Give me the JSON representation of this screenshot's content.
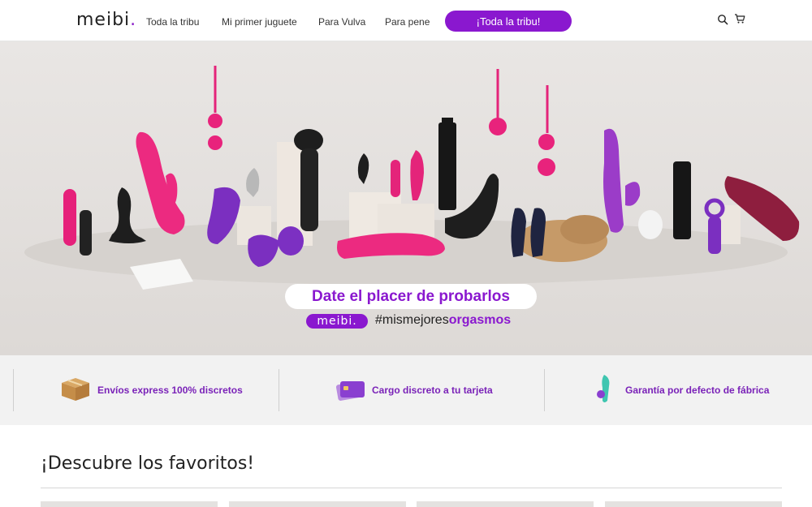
{
  "header": {
    "logo_text": "meibi",
    "logo_dot": ".",
    "nav": [
      "Toda la tribu",
      "Mi primer juguete",
      "Para Vulva",
      "Para pene"
    ],
    "cta_label": "¡Toda la tribu!",
    "icons": [
      "search-icon",
      "cart-icon"
    ]
  },
  "hero": {
    "headline": "Date el placer de probarlos",
    "brand_pill": "meibi.",
    "hashtag_prefix": "#mismejores",
    "hashtag_strong": "orgasmos"
  },
  "benefits": [
    {
      "icon": "box-icon",
      "text": "Envíos express 100% discretos"
    },
    {
      "icon": "card-icon",
      "text": "Cargo discreto a tu tarjeta"
    },
    {
      "icon": "toy-icon",
      "text": "Garantía por defecto de fábrica"
    }
  ],
  "favorites": {
    "title": "¡Descubre los favoritos!"
  },
  "colors": {
    "brand": "#8a18cf",
    "benefit_text": "#7a22b8",
    "hero_bg": "#e3e0dd",
    "benefits_bg": "#f2f2f2"
  }
}
